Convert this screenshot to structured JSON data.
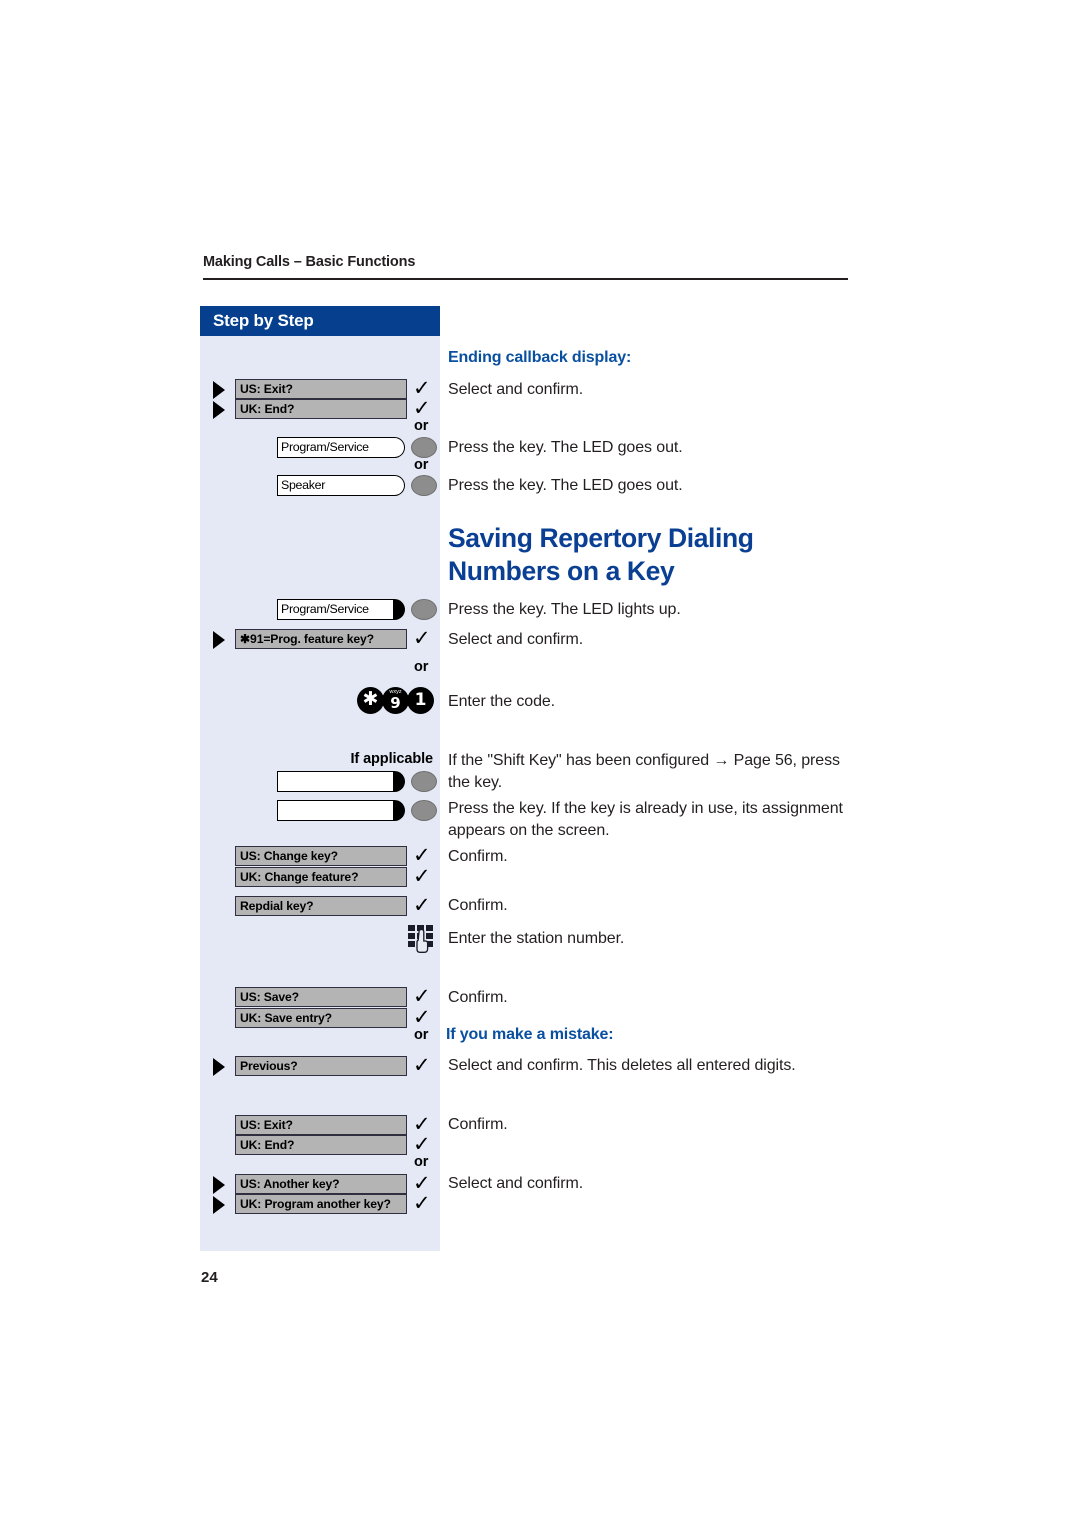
{
  "page": {
    "running_head": "Making Calls – Basic Functions",
    "folio": "24",
    "accent_blue": "#063f8e",
    "heading_blue": "#0a50a1",
    "title_blue": "#0a3f93",
    "panel_bg": "#e4e9f5",
    "display_box_bg": "#b4b4b4",
    "led_color": "#8d8d8d"
  },
  "sidebar": {
    "title": "Step by Step"
  },
  "sections": {
    "ending_callback": {
      "heading": "Ending callback display:",
      "text": "Select and confirm."
    },
    "main_title": "Saving Repertory Dialing Numbers on a Key",
    "if_applicable_label": "If applicable",
    "if_mistake_heading": "If you make a mistake:"
  },
  "or_labels": {
    "or": "or"
  },
  "steps": [
    {
      "id": "exit-1",
      "kind": "softkey",
      "options": [
        {
          "label": "US: Exit?",
          "triangle": true,
          "check": true
        },
        {
          "label": "UK: End?",
          "triangle": true,
          "check": true
        }
      ],
      "instruction": "Select and confirm."
    },
    {
      "id": "program-service-1",
      "kind": "fkey",
      "key_label": "Program/Service",
      "tab_filled": false,
      "instruction": "Press the key. The LED goes out."
    },
    {
      "id": "speaker-1",
      "kind": "fkey",
      "key_label": "Speaker",
      "tab_filled": false,
      "instruction": "Press the key. The LED goes out."
    },
    {
      "id": "program-service-2",
      "kind": "fkey",
      "key_label": "Program/Service",
      "tab_filled": true,
      "instruction": "Press the key. The LED lights up."
    },
    {
      "id": "prog-feature-key",
      "kind": "softkey",
      "options": [
        {
          "label": "✱91=Prog. feature key?",
          "triangle": true,
          "check": true
        }
      ],
      "instruction": "Select and confirm."
    },
    {
      "id": "enter-code",
      "kind": "code",
      "keys": [
        {
          "glyph": "✱",
          "sub": ""
        },
        {
          "glyph": "9",
          "sub": "wxyz"
        },
        {
          "glyph": "1",
          "sub": ""
        }
      ],
      "instruction": "Enter the code."
    },
    {
      "id": "shift-key",
      "kind": "fkey",
      "key_label": "",
      "tab_filled": true,
      "instruction": "If the \"Shift Key\" has been configured → Page 56, press the key."
    },
    {
      "id": "target-key",
      "kind": "fkey",
      "key_label": "",
      "tab_filled": true,
      "instruction": "Press the key. If the key is already in use, its assignment appears on the screen."
    },
    {
      "id": "change-key",
      "kind": "softkey",
      "options": [
        {
          "label": "US: Change key?",
          "triangle": false,
          "check": true
        },
        {
          "label": "UK: Change feature?",
          "triangle": false,
          "check": true
        }
      ],
      "instruction": "Confirm."
    },
    {
      "id": "repdial-key",
      "kind": "softkey",
      "options": [
        {
          "label": "Repdial key?",
          "triangle": false,
          "check": true
        }
      ],
      "instruction": "Confirm."
    },
    {
      "id": "station-number",
      "kind": "keypad",
      "instruction": "Enter the station number."
    },
    {
      "id": "save",
      "kind": "softkey",
      "options": [
        {
          "label": "US: Save?",
          "triangle": false,
          "check": true
        },
        {
          "label": "UK: Save entry?",
          "triangle": false,
          "check": true
        }
      ],
      "instruction": "Confirm."
    },
    {
      "id": "previous",
      "kind": "softkey",
      "options": [
        {
          "label": "Previous?",
          "triangle": true,
          "check": true
        }
      ],
      "instruction": "Select and confirm. This deletes all entered digits."
    },
    {
      "id": "exit-2",
      "kind": "softkey",
      "options": [
        {
          "label": "US: Exit?",
          "triangle": false,
          "check": true
        },
        {
          "label": "UK: End?",
          "triangle": false,
          "check": true
        }
      ],
      "instruction": "Confirm."
    },
    {
      "id": "another-key",
      "kind": "softkey",
      "options": [
        {
          "label": "US: Another key?",
          "triangle": true,
          "check": true
        },
        {
          "label": "UK: Program another key?",
          "triangle": true,
          "check": true
        }
      ],
      "instruction": "Select and confirm."
    }
  ],
  "glyphs": {
    "check": "✓",
    "arrow": "→"
  }
}
